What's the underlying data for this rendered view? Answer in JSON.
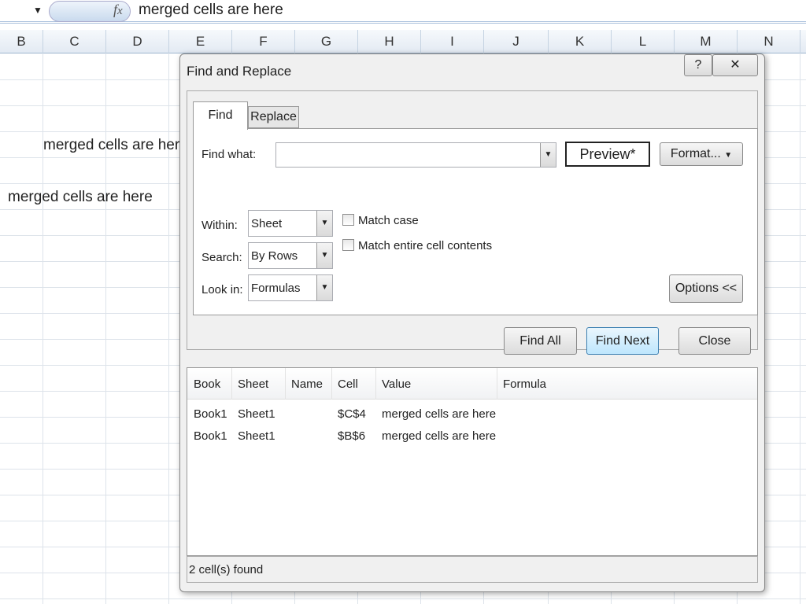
{
  "formula_bar": {
    "value": "merged cells are here",
    "fx": "fx"
  },
  "columns": [
    "B",
    "C",
    "D",
    "E",
    "F",
    "G",
    "H",
    "I",
    "J",
    "K",
    "L",
    "M",
    "N"
  ],
  "cells": [
    {
      "ref": "C4",
      "text": "merged cells are here"
    },
    {
      "ref": "B6",
      "text": "merged cells are here"
    }
  ],
  "dialog": {
    "title": "Find and Replace",
    "help": "?",
    "close": "✕",
    "tabs": [
      "Find",
      "Replace"
    ],
    "find_what_label": "Find what:",
    "find_what_value": "",
    "preview": "Preview*",
    "format": "Format...",
    "within_label": "Within:",
    "within_value": "Sheet",
    "search_label": "Search:",
    "search_value": "By Rows",
    "lookin_label": "Look in:",
    "lookin_value": "Formulas",
    "match_case": "Match case",
    "match_case_checked": false,
    "match_entire": "Match entire cell contents",
    "match_entire_checked": false,
    "options": "Options <<",
    "find_all": "Find All",
    "find_next": "Find Next",
    "close_btn": "Close",
    "results": {
      "headers": [
        "Book",
        "Sheet",
        "Name",
        "Cell",
        "Value",
        "Formula"
      ],
      "rows": [
        [
          "Book1",
          "Sheet1",
          "",
          "$C$4",
          "merged cells are here",
          ""
        ],
        [
          "Book1",
          "Sheet1",
          "",
          "$B$6",
          "merged cells are here",
          ""
        ]
      ]
    },
    "status": "2 cell(s) found"
  }
}
